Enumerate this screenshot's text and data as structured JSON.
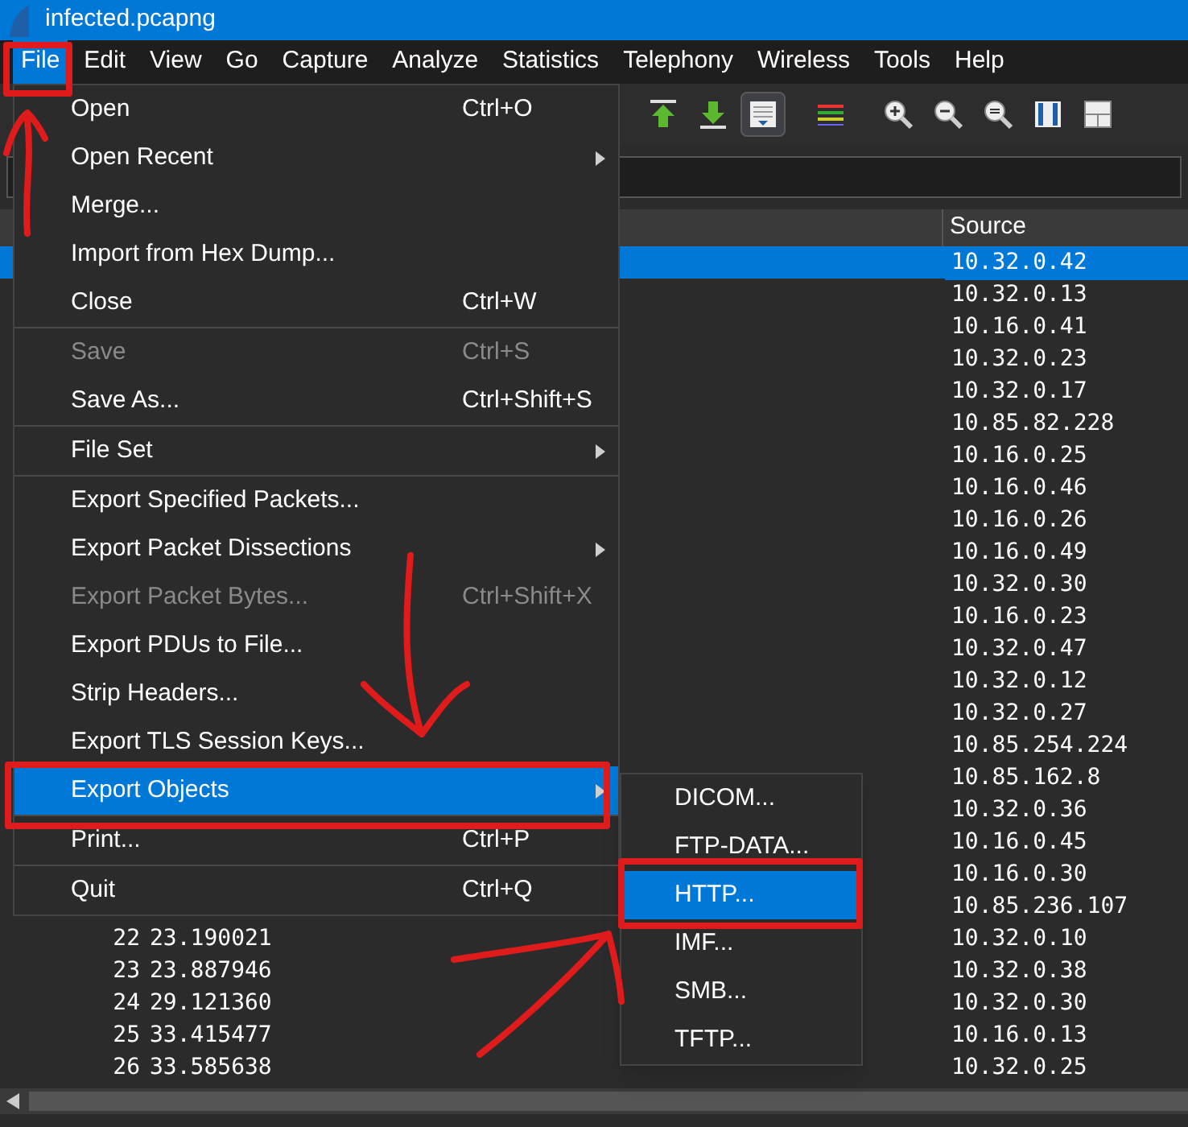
{
  "window": {
    "title": "infected.pcapng"
  },
  "menu_bar": [
    {
      "label": "File",
      "selected": true
    },
    {
      "label": "Edit",
      "selected": false
    },
    {
      "label": "View",
      "selected": false
    },
    {
      "label": "Go",
      "selected": false
    },
    {
      "label": "Capture",
      "selected": false
    },
    {
      "label": "Analyze",
      "selected": false
    },
    {
      "label": "Statistics",
      "selected": false
    },
    {
      "label": "Telephony",
      "selected": false
    },
    {
      "label": "Wireless",
      "selected": false
    },
    {
      "label": "Tools",
      "selected": false
    },
    {
      "label": "Help",
      "selected": false
    }
  ],
  "file_menu": {
    "sections": [
      [
        {
          "label": "Open",
          "shortcut": "Ctrl+O",
          "submenu": false,
          "disabled": false,
          "selected": false
        },
        {
          "label": "Open Recent",
          "submenu": true,
          "disabled": false,
          "selected": false
        },
        {
          "label": "Merge...",
          "submenu": false,
          "disabled": false,
          "selected": false
        },
        {
          "label": "Import from Hex Dump...",
          "submenu": false,
          "disabled": false,
          "selected": false
        },
        {
          "label": "Close",
          "shortcut": "Ctrl+W",
          "submenu": false,
          "disabled": false,
          "selected": false
        }
      ],
      [
        {
          "label": "Save",
          "shortcut": "Ctrl+S",
          "submenu": false,
          "disabled": true,
          "selected": false
        },
        {
          "label": "Save As...",
          "shortcut": "Ctrl+Shift+S",
          "submenu": false,
          "disabled": false,
          "selected": false
        }
      ],
      [
        {
          "label": "File Set",
          "submenu": true,
          "disabled": false,
          "selected": false
        }
      ],
      [
        {
          "label": "Export Specified Packets...",
          "submenu": false,
          "disabled": false,
          "selected": false
        },
        {
          "label": "Export Packet Dissections",
          "submenu": true,
          "disabled": false,
          "selected": false
        },
        {
          "label": "Export Packet Bytes...",
          "shortcut": "Ctrl+Shift+X",
          "submenu": false,
          "disabled": true,
          "selected": false
        },
        {
          "label": "Export PDUs to File...",
          "submenu": false,
          "disabled": false,
          "selected": false
        },
        {
          "label": "Strip Headers...",
          "submenu": false,
          "disabled": false,
          "selected": false
        },
        {
          "label": "Export TLS Session Keys...",
          "submenu": false,
          "disabled": false,
          "selected": false
        },
        {
          "label": "Export Objects",
          "submenu": true,
          "disabled": false,
          "selected": true
        }
      ],
      [
        {
          "label": "Print...",
          "shortcut": "Ctrl+P",
          "submenu": false,
          "disabled": false,
          "selected": false
        }
      ],
      [
        {
          "label": "Quit",
          "shortcut": "Ctrl+Q",
          "submenu": false,
          "disabled": false,
          "selected": false
        }
      ]
    ]
  },
  "export_objects_menu": [
    {
      "label": "DICOM...",
      "selected": false
    },
    {
      "label": "FTP-DATA...",
      "selected": false
    },
    {
      "label": "HTTP...",
      "selected": true
    },
    {
      "label": "IMF...",
      "selected": false
    },
    {
      "label": "SMB...",
      "selected": false
    },
    {
      "label": "TFTP...",
      "selected": false
    }
  ],
  "packet_list": {
    "columns": [
      {
        "label": "Source"
      }
    ],
    "rows": [
      {
        "source": "10.32.0.42",
        "selected": true
      },
      {
        "source": "10.32.0.13",
        "selected": false
      },
      {
        "source": "10.16.0.41",
        "selected": false
      },
      {
        "source": "10.32.0.23",
        "selected": false
      },
      {
        "source": "10.32.0.17",
        "selected": false
      },
      {
        "source": "10.85.82.228",
        "selected": false
      },
      {
        "source": "10.16.0.25",
        "selected": false
      },
      {
        "source": "10.16.0.46",
        "selected": false
      },
      {
        "source": "10.16.0.26",
        "selected": false
      },
      {
        "source": "10.16.0.49",
        "selected": false
      },
      {
        "source": "10.32.0.30",
        "selected": false
      },
      {
        "source": "10.16.0.23",
        "selected": false
      },
      {
        "source": "10.32.0.47",
        "selected": false
      },
      {
        "source": "10.32.0.12",
        "selected": false
      },
      {
        "source": "10.32.0.27",
        "selected": false
      },
      {
        "source": "10.85.254.224",
        "selected": false
      },
      {
        "source": "10.85.162.8",
        "selected": false
      },
      {
        "source": "10.32.0.36",
        "selected": false
      },
      {
        "source": "10.16.0.45",
        "selected": false
      },
      {
        "source": "10.16.0.30",
        "selected": false
      },
      {
        "source": "10.85.236.107",
        "selected": false
      },
      {
        "no": "22",
        "time": "23.190021",
        "source": "10.32.0.10",
        "selected": false
      },
      {
        "no": "23",
        "time": "23.887946",
        "source": "10.32.0.38",
        "selected": false
      },
      {
        "no": "24",
        "time": "29.121360",
        "source": "10.32.0.30",
        "selected": false
      },
      {
        "no": "25",
        "time": "33.415477",
        "source": "10.16.0.13",
        "selected": false
      },
      {
        "no": "26",
        "time": "33.585638",
        "source": "10.32.0.25",
        "selected": false
      }
    ]
  }
}
